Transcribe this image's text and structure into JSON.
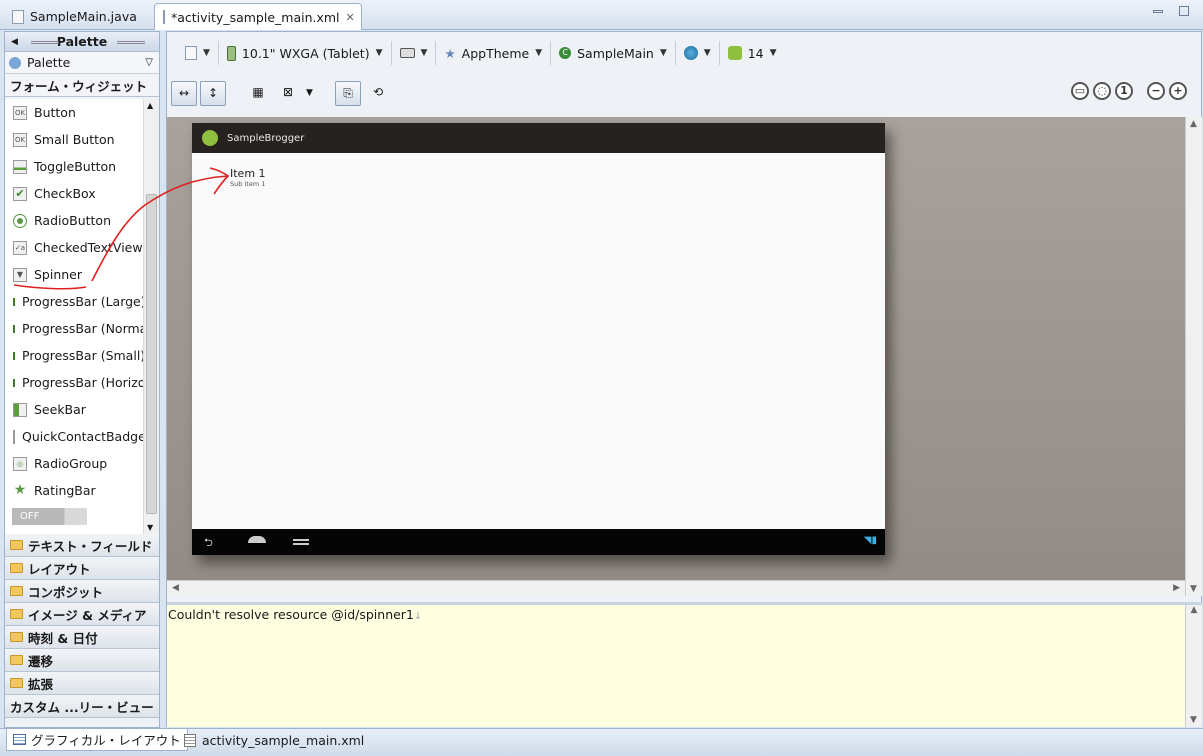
{
  "tabs": [
    {
      "label": "SampleMain.java"
    },
    {
      "label": "*activity_sample_main.xml"
    }
  ],
  "palette": {
    "title": "Palette",
    "dropdown": "Palette",
    "open_category": "フォーム・ウィジェット",
    "widgets": [
      "Button",
      "Small Button",
      "ToggleButton",
      "CheckBox",
      "RadioButton",
      "CheckedTextView",
      "Spinner",
      "ProgressBar (Large)",
      "ProgressBar (Normal)",
      "ProgressBar (Small)",
      "ProgressBar (Horizontal)",
      "SeekBar",
      "QuickContactBadge",
      "RadioGroup",
      "RatingBar"
    ],
    "toggle_text": "OFF",
    "categories": [
      "テキスト・フィールド",
      "レイアウト",
      "コンポジット",
      "イメージ & メディア",
      "時刻 & 日付",
      "遷移",
      "拡張",
      "カスタム ...リー・ビュー"
    ]
  },
  "toolbar": {
    "device": "10.1\" WXGA (Tablet)",
    "theme": "AppTheme",
    "activity": "SampleMain",
    "api": "14"
  },
  "preview": {
    "app_title": "SampleBrogger",
    "item_title": "Item 1",
    "item_sub": "Sub Item 1"
  },
  "error": {
    "message": "Couldn't resolve resource @id/spinner1"
  },
  "bottom_tabs": [
    "グラフィカル・レイアウト",
    "activity_sample_main.xml"
  ],
  "colors": {
    "annotation": "#e02020",
    "android_green": "#8fbf3f"
  }
}
